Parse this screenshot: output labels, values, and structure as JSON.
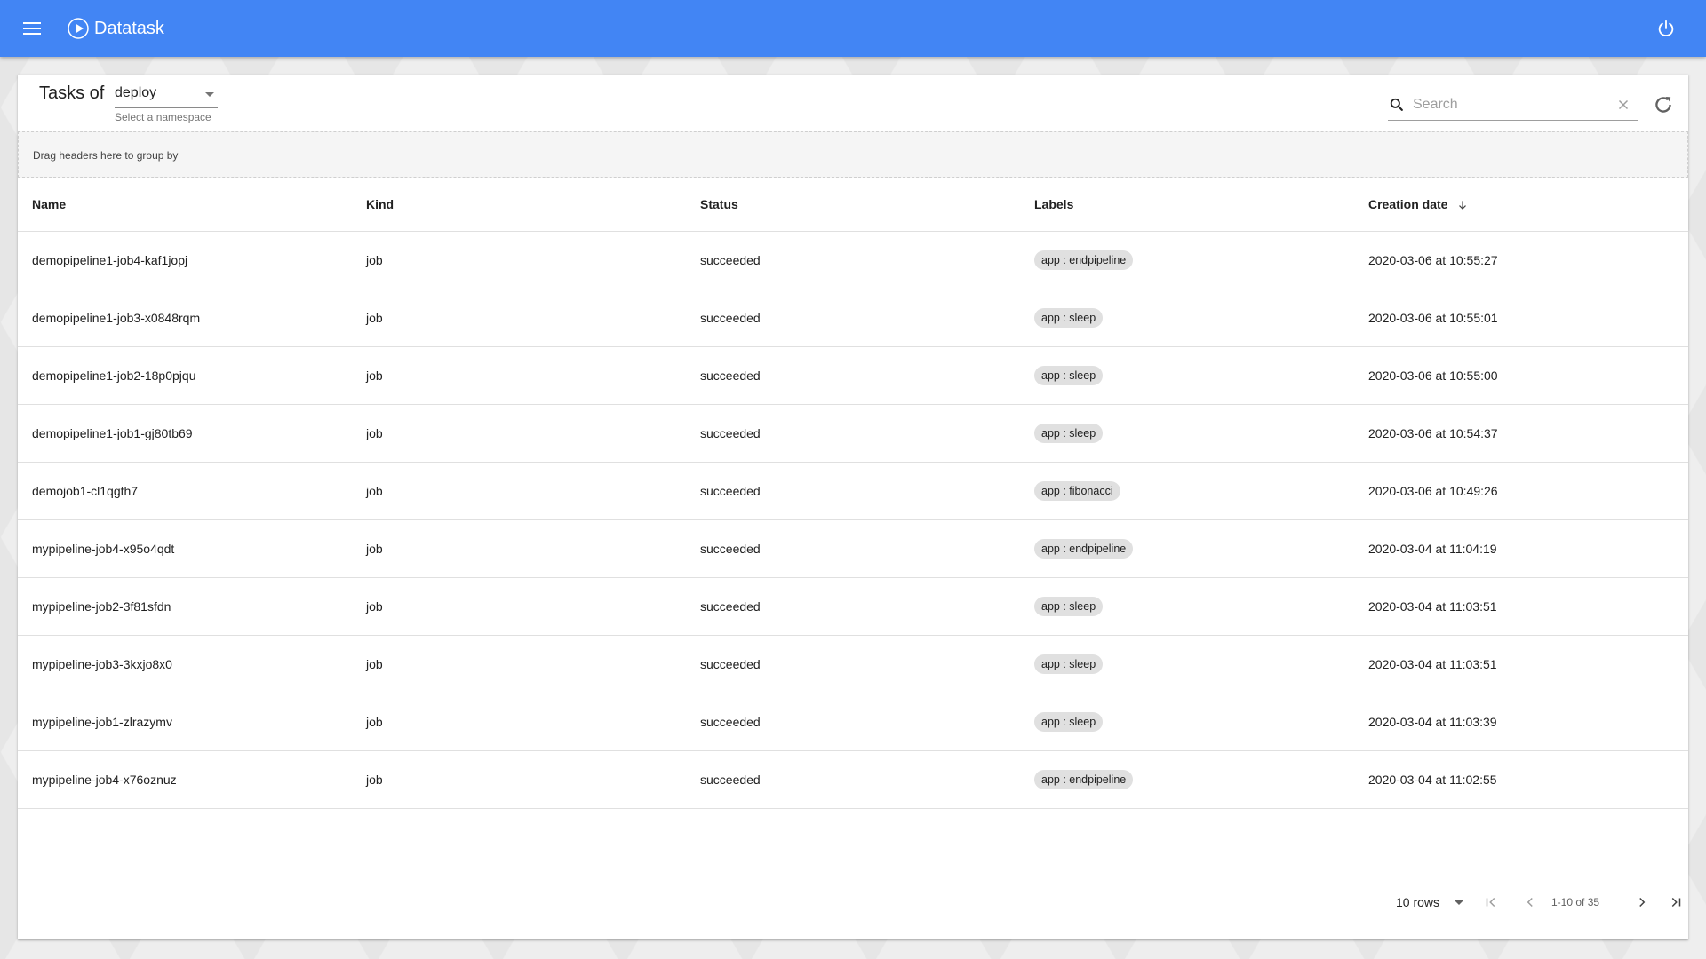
{
  "app": {
    "title": "Datatask",
    "colors": {
      "primary": "#4285f4",
      "chip": "#e0e0e0",
      "group_panel": "#f5f5f5"
    },
    "icons": {
      "menu": "menu-icon",
      "logo": "play-circle-icon",
      "power": "power-icon"
    }
  },
  "header": {
    "tasks_of_label": "Tasks of",
    "namespace": {
      "value": "deploy",
      "helper": "Select a namespace"
    },
    "search": {
      "placeholder": "Search",
      "value": ""
    },
    "icons": {
      "search": "search-icon",
      "clear": "close-icon",
      "refresh": "refresh-icon"
    }
  },
  "group_panel": {
    "text": "Drag headers here to group by"
  },
  "table": {
    "columns": [
      "Name",
      "Kind",
      "Status",
      "Labels",
      "Creation date"
    ],
    "sort": {
      "column": "Creation date",
      "direction": "descending",
      "icon": "arrow-down-icon"
    },
    "rows": [
      {
        "name": "demopipeline1-job4-kaf1jopj",
        "kind": "job",
        "status": "succeeded",
        "label": "app : endpipeline",
        "created": "2020-03-06 at 10:55:27"
      },
      {
        "name": "demopipeline1-job3-x0848rqm",
        "kind": "job",
        "status": "succeeded",
        "label": "app : sleep",
        "created": "2020-03-06 at 10:55:01"
      },
      {
        "name": "demopipeline1-job2-18p0pjqu",
        "kind": "job",
        "status": "succeeded",
        "label": "app : sleep",
        "created": "2020-03-06 at 10:55:00"
      },
      {
        "name": "demopipeline1-job1-gj80tb69",
        "kind": "job",
        "status": "succeeded",
        "label": "app : sleep",
        "created": "2020-03-06 at 10:54:37"
      },
      {
        "name": "demojob1-cl1qgth7",
        "kind": "job",
        "status": "succeeded",
        "label": "app : fibonacci",
        "created": "2020-03-06 at 10:49:26"
      },
      {
        "name": "mypipeline-job4-x95o4qdt",
        "kind": "job",
        "status": "succeeded",
        "label": "app : endpipeline",
        "created": "2020-03-04 at 11:04:19"
      },
      {
        "name": "mypipeline-job2-3f81sfdn",
        "kind": "job",
        "status": "succeeded",
        "label": "app : sleep",
        "created": "2020-03-04 at 11:03:51"
      },
      {
        "name": "mypipeline-job3-3kxjo8x0",
        "kind": "job",
        "status": "succeeded",
        "label": "app : sleep",
        "created": "2020-03-04 at 11:03:51"
      },
      {
        "name": "mypipeline-job1-zlrazymv",
        "kind": "job",
        "status": "succeeded",
        "label": "app : sleep",
        "created": "2020-03-04 at 11:03:39"
      },
      {
        "name": "mypipeline-job4-x76oznuz",
        "kind": "job",
        "status": "succeeded",
        "label": "app : endpipeline",
        "created": "2020-03-04 at 11:02:55"
      }
    ]
  },
  "pager": {
    "rows_per_page": "10 rows",
    "range": "1-10 of 35",
    "icons": {
      "first": "first-page-icon",
      "prev": "chevron-left-icon",
      "next": "chevron-right-icon",
      "last": "last-page-icon"
    }
  }
}
